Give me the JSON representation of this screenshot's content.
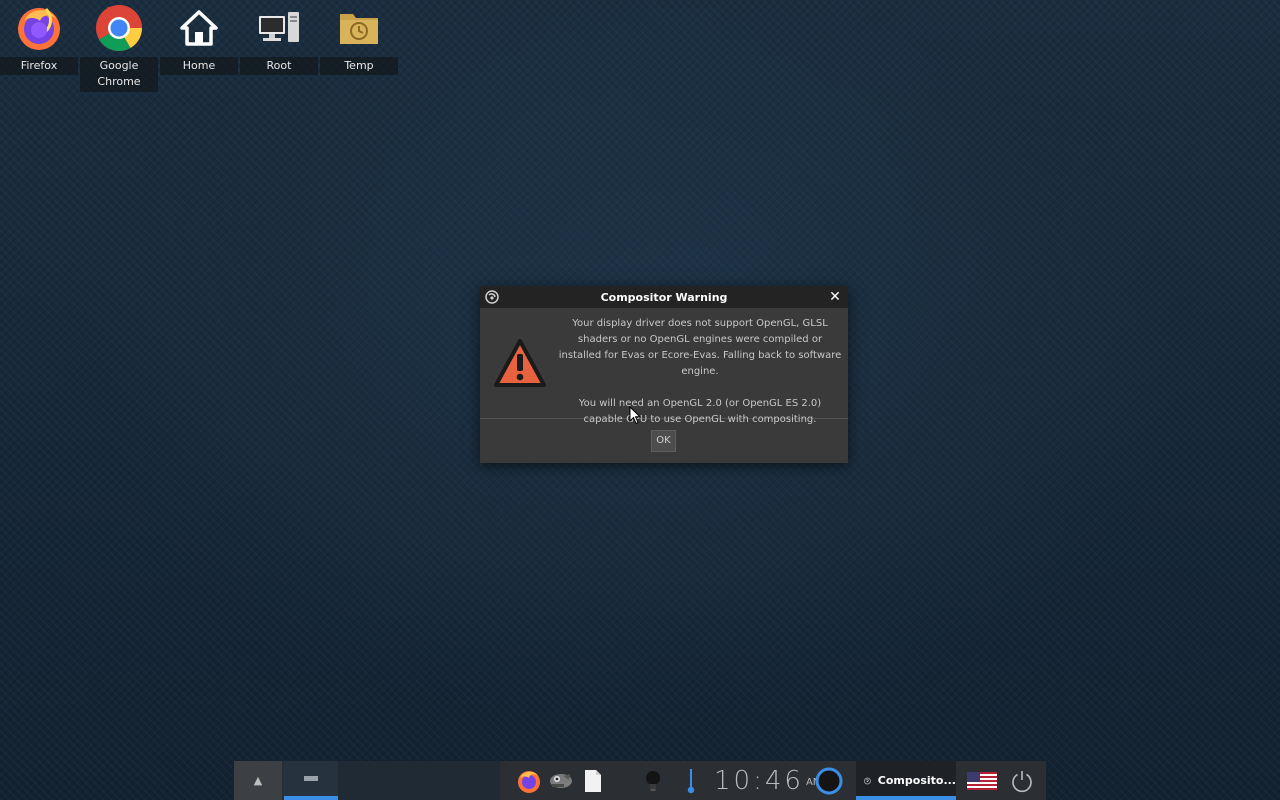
{
  "desktop": {
    "icons": [
      {
        "label": "Firefox",
        "icon": "firefox-icon"
      },
      {
        "label": "Google Chrome",
        "label_line1": "Google",
        "label_line2": "Chrome",
        "icon": "chrome-icon"
      },
      {
        "label": "Home",
        "icon": "home-icon"
      },
      {
        "label": "Root",
        "icon": "computer-icon"
      },
      {
        "label": "Temp",
        "icon": "temp-folder-icon"
      }
    ]
  },
  "dialog": {
    "title": "Compositor Warning",
    "close_glyph": "✕",
    "message_1": "Your display driver does not support OpenGL, GLSL shaders or no OpenGL engines were compiled or installed for Evas or Ecore-Evas. Falling back to software engine.",
    "message_2": "You will need an OpenGL 2.0 (or OpenGL ES 2.0) capable GPU to use OpenGL with compositing.",
    "ok_label": "OK",
    "icon": "warning-icon"
  },
  "taskbar": {
    "up_glyph": "▲",
    "clock_time": "10:46",
    "clock_ampm": "AM",
    "active_task": "Composito...",
    "keyboard_layout": "us-flag-icon",
    "accent_color": "#3a8ee6"
  }
}
